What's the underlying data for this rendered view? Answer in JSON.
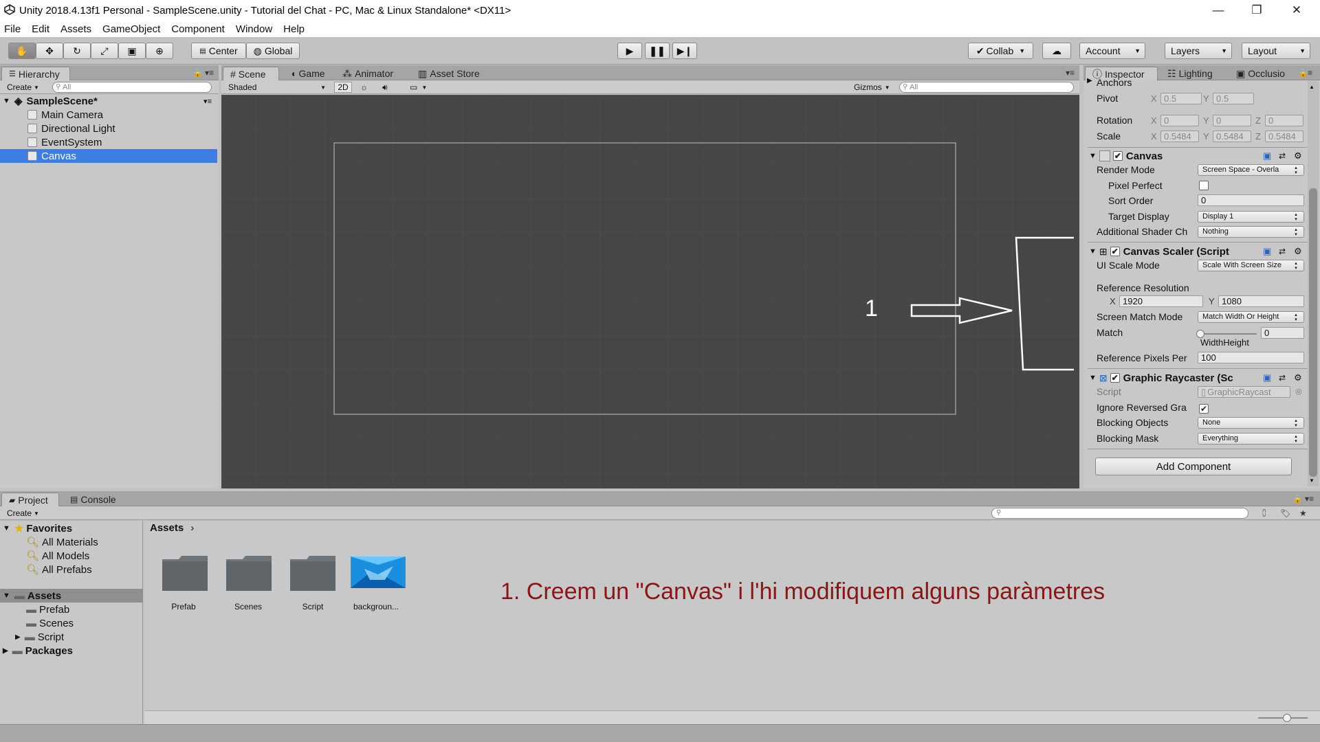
{
  "window": {
    "title": "Unity 2018.4.13f1 Personal - SampleScene.unity - Tutorial del Chat - PC, Mac & Linux Standalone* <DX11>",
    "minimize": "—",
    "maximize": "❐",
    "close": "✕"
  },
  "menu": [
    "File",
    "Edit",
    "Assets",
    "GameObject",
    "Component",
    "Window",
    "Help"
  ],
  "toolbar": {
    "center": "Center",
    "global": "Global",
    "collab": "Collab",
    "account": "Account",
    "layers": "Layers",
    "layout": "Layout"
  },
  "hierarchy": {
    "tab": "Hierarchy",
    "create": "Create",
    "search_placeholder": "All",
    "scene": "SampleScene*",
    "items": [
      "Main Camera",
      "Directional Light",
      "EventSystem",
      "Canvas"
    ],
    "selected": "Canvas"
  },
  "scene_view": {
    "tabs": [
      "Scene",
      "Game",
      "Animator",
      "Asset Store"
    ],
    "shading": "Shaded",
    "mode_2d": "2D",
    "gizmos": "Gizmos",
    "search_placeholder": "All",
    "annotation_number": "1"
  },
  "inspector": {
    "tabs": [
      "Inspector",
      "Lighting",
      "Occlusio"
    ],
    "anchors_label": "Anchors",
    "pivot": {
      "label": "Pivot",
      "x": "0.5",
      "y": "0.5"
    },
    "rotation": {
      "label": "Rotation",
      "x": "0",
      "y": "0",
      "z": "0"
    },
    "scale": {
      "label": "Scale",
      "x": "0.5484",
      "y": "0.5484",
      "z": "0.5484"
    },
    "canvas": {
      "title": "Canvas",
      "render_mode_label": "Render Mode",
      "render_mode": "Screen Space - Overla",
      "pixel_perfect_label": "Pixel Perfect",
      "sort_order_label": "Sort Order",
      "sort_order": "0",
      "target_display_label": "Target Display",
      "target_display": "Display 1",
      "additional_shader_label": "Additional Shader Ch",
      "additional_shader": "Nothing"
    },
    "canvas_scaler": {
      "title": "Canvas Scaler (Script",
      "ui_scale_mode_label": "UI Scale Mode",
      "ui_scale_mode": "Scale With Screen Size",
      "ref_res_label": "Reference Resolution",
      "ref_x": "1920",
      "ref_y": "1080",
      "screen_match_label": "Screen Match Mode",
      "screen_match": "Match Width Or Height",
      "match_label": "Match",
      "match_value": "0",
      "match_fraction": 0,
      "width_height": "WidthHeight",
      "ref_pixels_label": "Reference Pixels Per",
      "ref_pixels": "100"
    },
    "graphic_raycaster": {
      "title": "Graphic Raycaster (Sc",
      "script_label": "Script",
      "script": "GraphicRaycast",
      "ignore_reversed_label": "Ignore Reversed Gra",
      "blocking_objects_label": "Blocking Objects",
      "blocking_objects": "None",
      "blocking_mask_label": "Blocking Mask",
      "blocking_mask": "Everything"
    },
    "add_component": "Add Component"
  },
  "project": {
    "tabs": [
      "Project",
      "Console"
    ],
    "create": "Create",
    "favorites_label": "Favorites",
    "favorites": [
      "All Materials",
      "All Models",
      "All Prefabs"
    ],
    "assets_label": "Assets",
    "asset_folders": [
      "Prefab",
      "Scenes",
      "Script"
    ],
    "packages_label": "Packages",
    "breadcrumb": "Assets",
    "grid_items": [
      "Prefab",
      "Scenes",
      "Script",
      "backgroun..."
    ],
    "caption": "1. Creem un \"Canvas\" i l'hi modifiquem alguns paràmetres"
  },
  "colors": {
    "selection": "#3e7de2",
    "scene_bg": "#464646",
    "caption": "#8b1414"
  }
}
